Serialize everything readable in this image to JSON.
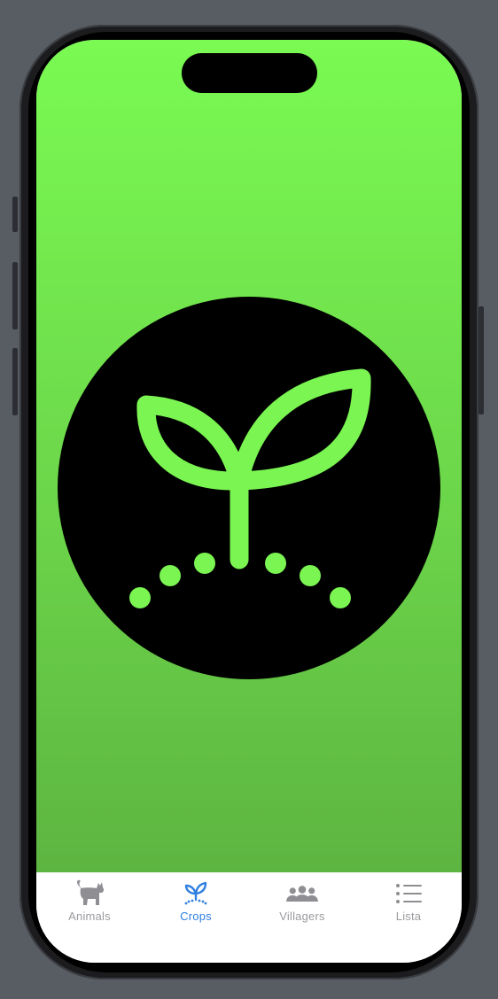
{
  "app": {
    "hero_icon": "sprout-icon",
    "background_color": "#74ee4f",
    "icon_circle_color": "#000000",
    "icon_glyph_color": "#7af552"
  },
  "tabbar": {
    "selected": "Crops",
    "active_color": "#2f7fe0",
    "inactive_color": "#9b9ba0",
    "tabs": [
      {
        "label": "Animals",
        "icon": "cat-icon"
      },
      {
        "label": "Crops",
        "icon": "sprout-icon"
      },
      {
        "label": "Villagers",
        "icon": "people-icon"
      },
      {
        "label": "Lista",
        "icon": "list-icon"
      }
    ]
  }
}
